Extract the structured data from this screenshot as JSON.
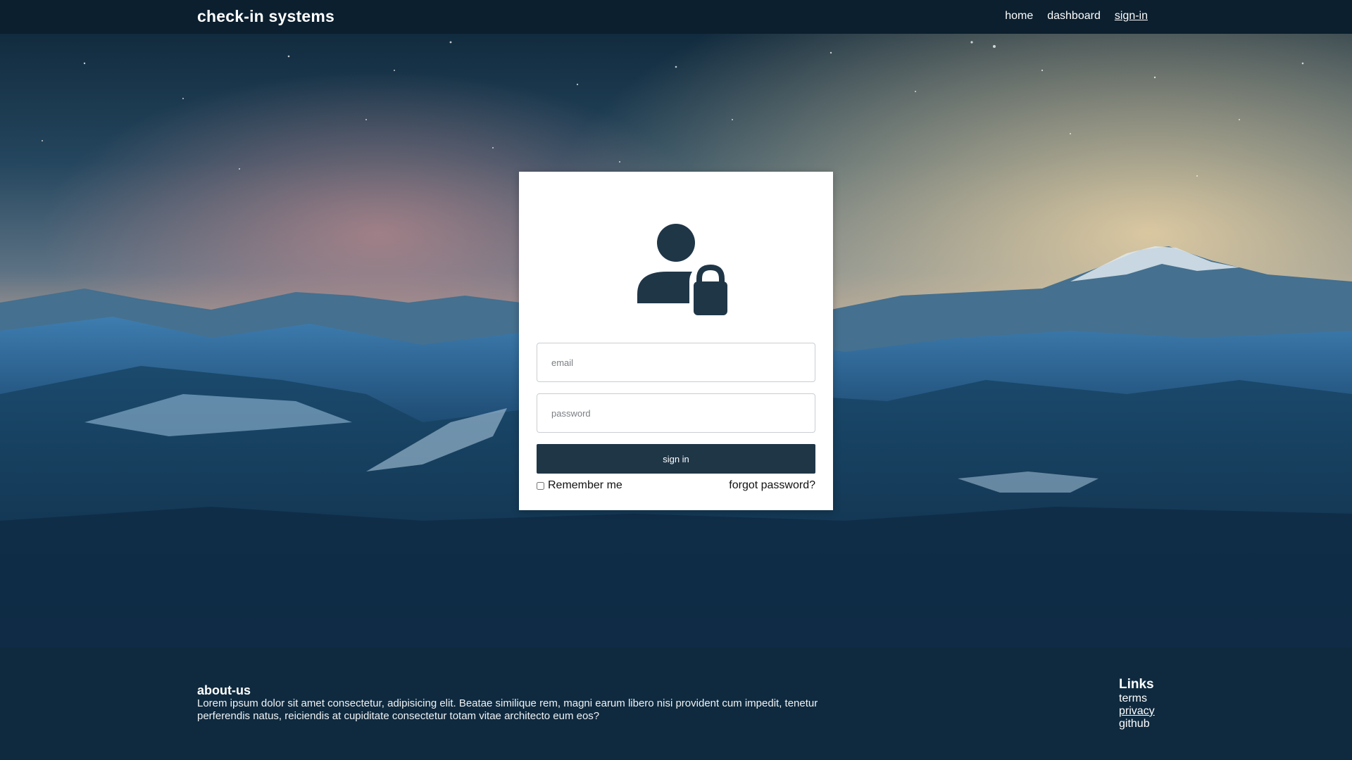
{
  "navbar": {
    "brand": "check-in systems",
    "links": [
      {
        "label": "home",
        "active": false
      },
      {
        "label": "dashboard",
        "active": false
      },
      {
        "label": "sign-in",
        "active": true
      }
    ]
  },
  "login": {
    "icon": "user-lock-icon",
    "email_placeholder": "email",
    "password_placeholder": "password",
    "submit_label": "sign in",
    "remember_label": "Remember me",
    "remember_checked": false,
    "forgot_label": "forgot password?"
  },
  "footer": {
    "about_title": "about-us",
    "about_text": "Lorem ipsum dolor sit amet consectetur, adipisicing elit. Beatae similique rem, magni earum libero nisi provident cum impedit, tenetur perferendis natus, reiciendis at cupiditate consectetur totam vitae architecto eum eos?",
    "links_title": "Links",
    "links": [
      "terms",
      "privacy",
      "github"
    ]
  },
  "colors": {
    "navbar": "#0b1f2e",
    "footer": "#0f2a3f",
    "button": "#1f3647",
    "icon": "#1f3647"
  }
}
